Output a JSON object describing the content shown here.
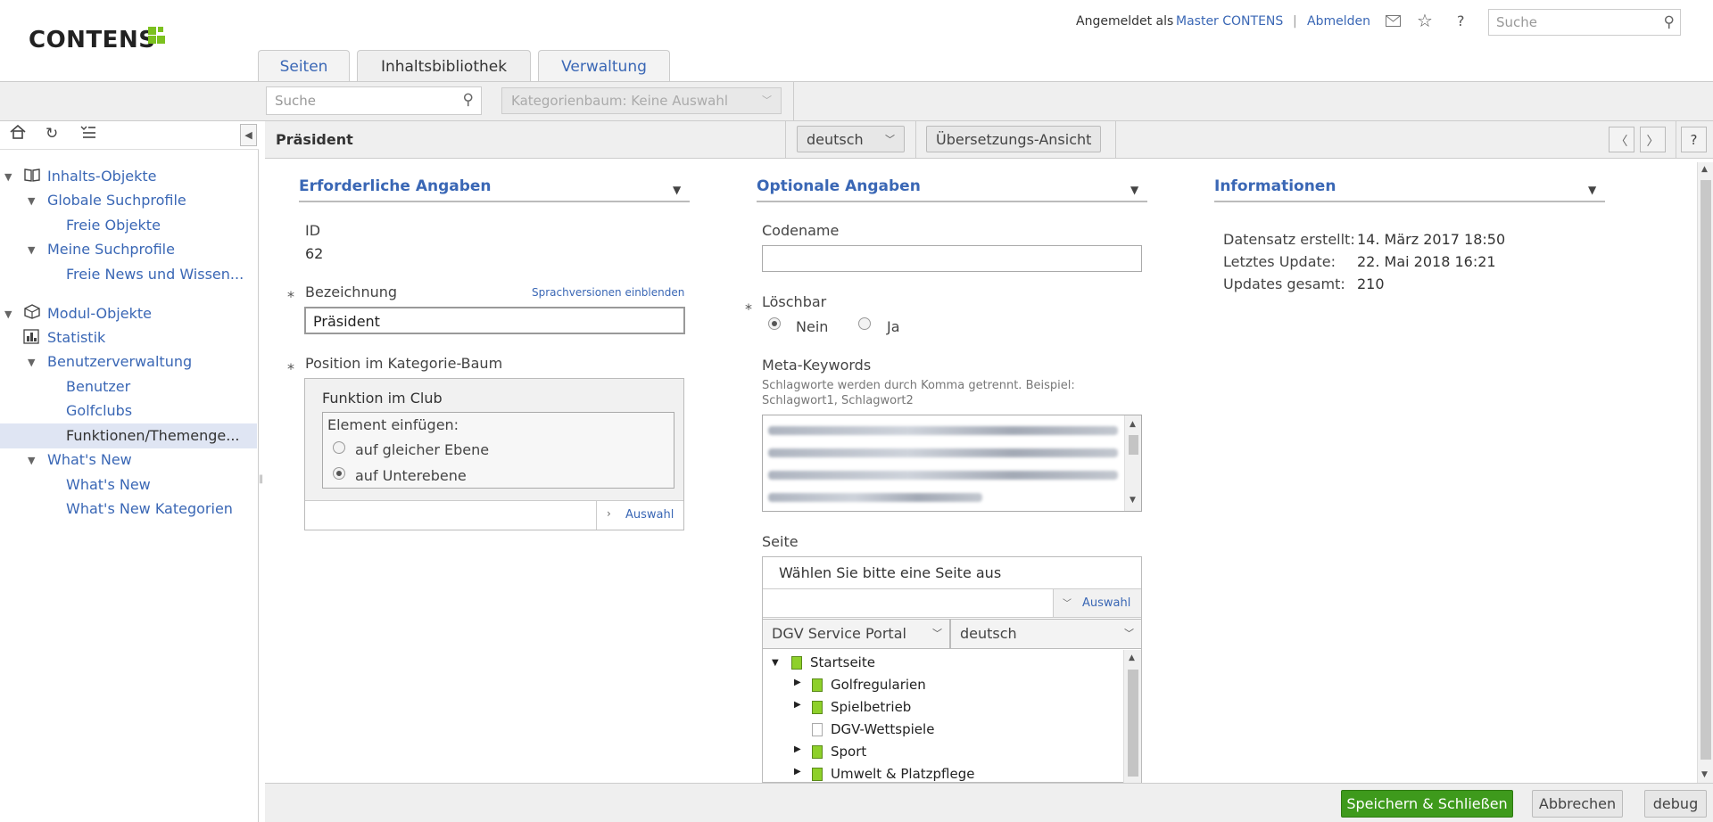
{
  "header": {
    "logo_text": "CONTENS",
    "logged_in_prefix": "Angemeldet als",
    "user_name": "Master CONTENS",
    "separator": "|",
    "logout": "Abmelden",
    "search_placeholder": "Suche"
  },
  "tabs": [
    {
      "label": "Seiten"
    },
    {
      "label": "Inhaltsbibliothek"
    },
    {
      "label": "Verwaltung"
    }
  ],
  "toolbar": {
    "search_placeholder": "Suche",
    "category_tree": "Kategorienbaum: Keine Auswahl"
  },
  "tree": {
    "items": [
      {
        "label": "Inhalts-Objekte"
      },
      {
        "label": "Globale Suchprofile"
      },
      {
        "label": "Freie Objekte"
      },
      {
        "label": "Meine Suchprofile"
      },
      {
        "label": "Freie News und Wissen..."
      },
      {
        "label": "Modul-Objekte"
      },
      {
        "label": "Statistik"
      },
      {
        "label": "Benutzerverwaltung"
      },
      {
        "label": "Benutzer"
      },
      {
        "label": "Golfclubs"
      },
      {
        "label": "Funktionen/Themenge..."
      },
      {
        "label": "What's New"
      },
      {
        "label": "What's New"
      },
      {
        "label": "What's New Kategorien"
      }
    ]
  },
  "content": {
    "title": "Präsident",
    "language": "deutsch",
    "translation_view": "Übersetzungs-Ansicht",
    "help": "?"
  },
  "required": {
    "title": "Erforderliche Angaben",
    "id_label": "ID",
    "id_value": "62",
    "name_label": "Bezeichnung",
    "show_lang_versions": "Sprachversionen einblenden",
    "name_value": "Präsident",
    "position_label": "Position im Kategorie-Baum",
    "category_name": "Funktion im Club",
    "insert_label": "Element einfügen:",
    "same_level": "auf gleicher Ebene",
    "sub_level": "auf Unterebene",
    "select_link": "Auswahl"
  },
  "optional": {
    "title": "Optionale Angaben",
    "codename_label": "Codename",
    "codename_value": "",
    "deletable_label": "Löschbar",
    "no_label": "Nein",
    "yes_label": "Ja",
    "keywords_label": "Meta-Keywords",
    "keywords_hint": "Schlagworte werden durch Komma getrennt. Beispiel: Schlagwort1, Schlagwort2",
    "page_label": "Seite",
    "page_placeholder": "Wählen Sie bitte eine Seite aus",
    "select_link": "Auswahl",
    "portal": "DGV Service Portal",
    "page_language": "deutsch",
    "page_tree": [
      {
        "label": "Startseite"
      },
      {
        "label": "Golfregularien"
      },
      {
        "label": "Spielbetrieb"
      },
      {
        "label": "DGV-Wettspiele"
      },
      {
        "label": "Sport"
      },
      {
        "label": "Umwelt & Platzpflege"
      }
    ]
  },
  "info": {
    "title": "Informationen",
    "created_label": "Datensatz erstellt:",
    "created_value": "14. März 2017 18:50",
    "updated_label": "Letztes Update:",
    "updated_value": "22. Mai 2018 16:21",
    "total_label": "Updates gesamt:",
    "total_value": "210"
  },
  "footer": {
    "save": "Speichern & Schließen",
    "cancel": "Abbrechen",
    "debug": "debug"
  },
  "colors": {
    "accent": "#3a67b5",
    "brand_green": "#7cc11f",
    "save_green": "#3e9a1c"
  }
}
